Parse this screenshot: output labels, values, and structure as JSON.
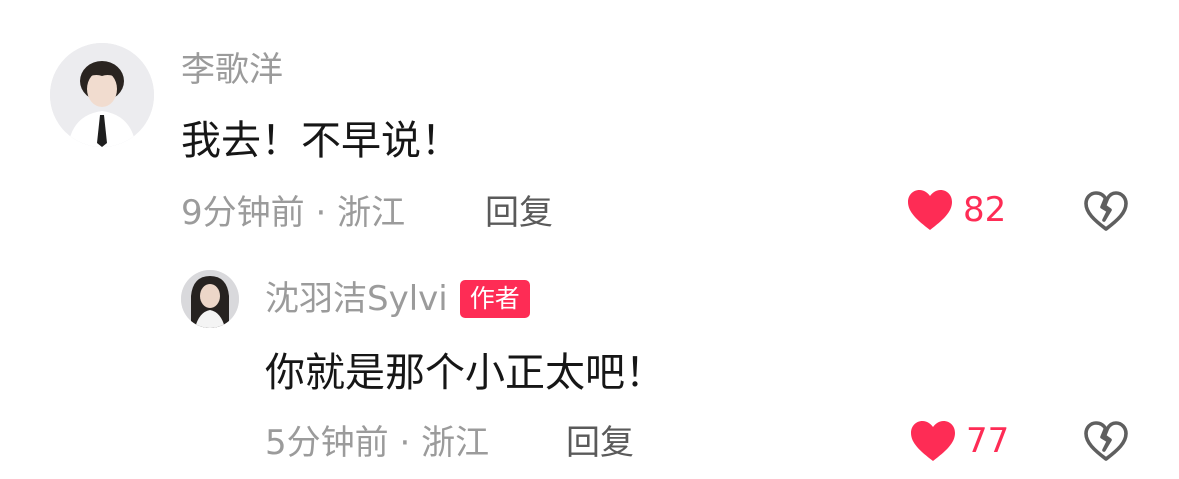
{
  "comment": {
    "username": "李歌洋",
    "text": "我去！不早说！",
    "time": "9分钟前",
    "separator": "·",
    "location": "浙江",
    "reply_label": "回复",
    "like_count": "82"
  },
  "reply": {
    "username": "沈羽洁Sylvi",
    "badge": "作者",
    "text": "你就是那个小正太吧！",
    "time": "5分钟前",
    "separator": "·",
    "location": "浙江",
    "reply_label": "回复",
    "like_count": "77"
  },
  "colors": {
    "accent": "#fe2c55",
    "meta_text": "#9b9b9b",
    "body_text": "#161616"
  },
  "icons": {
    "like": "heart-icon",
    "dislike": "broken-heart-icon"
  }
}
